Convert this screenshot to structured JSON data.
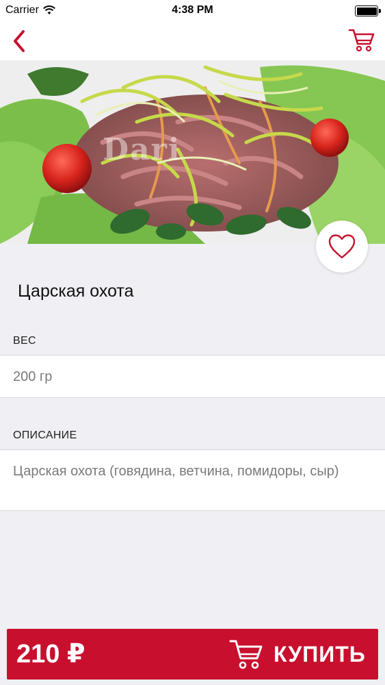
{
  "status_bar": {
    "carrier": "Carrier",
    "time": "4:38 PM"
  },
  "nav": {
    "back_icon": "chevron-left-icon",
    "cart_icon": "cart-icon",
    "accent_color": "#c8102e"
  },
  "hero": {
    "watermark": "Dari"
  },
  "product": {
    "title": "Царская охота",
    "favorite_icon": "heart-icon"
  },
  "sections": {
    "weight_label": "ВЕС",
    "weight_value": "200 гр",
    "description_label": "ОПИСАНИЕ",
    "description_value": "Царская охота (говядина, ветчина, помидоры, сыр)"
  },
  "buy_bar": {
    "price": "210 ₽",
    "label": "КУПИТЬ",
    "color": "#c8102e"
  }
}
